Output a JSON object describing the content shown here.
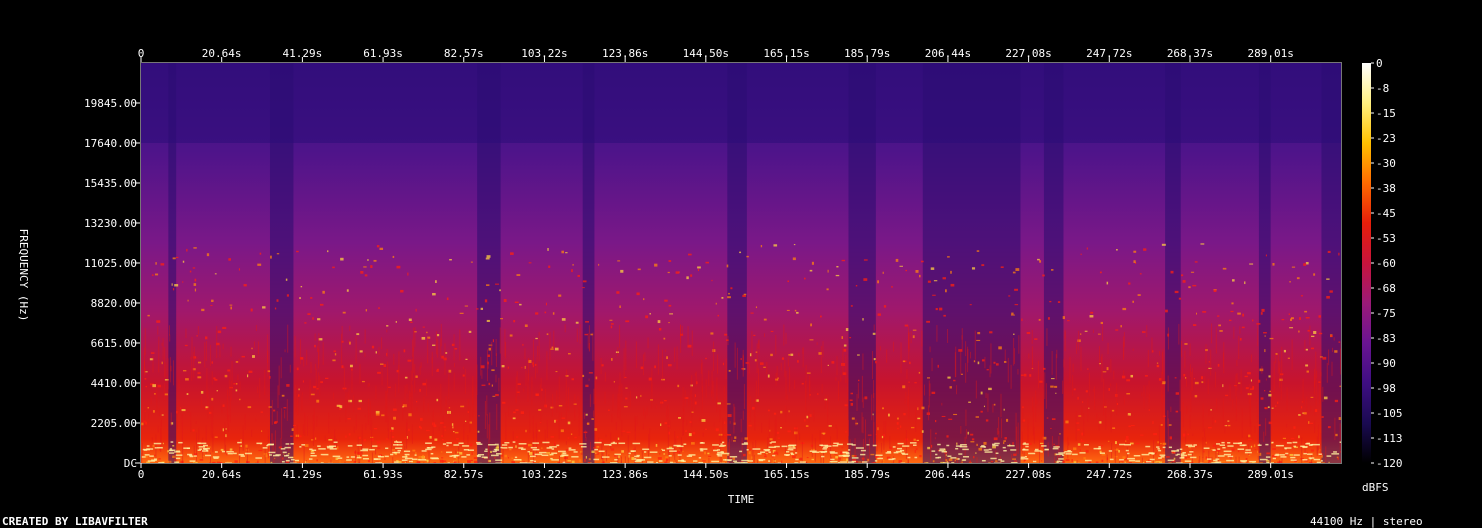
{
  "chart_data": {
    "type": "heatmap",
    "title": "",
    "xlabel": "TIME",
    "ylabel": "FREQUENCY (Hz)",
    "x_ticks": [
      "0",
      "20.64s",
      "41.29s",
      "61.93s",
      "82.57s",
      "103.22s",
      "123.86s",
      "144.50s",
      "165.15s",
      "185.79s",
      "206.44s",
      "227.08s",
      "247.72s",
      "268.37s",
      "289.01s"
    ],
    "x_tick_values": [
      0,
      20.64,
      41.29,
      61.93,
      82.57,
      103.22,
      123.86,
      144.5,
      165.15,
      185.79,
      206.44,
      227.08,
      247.72,
      268.37,
      289.01
    ],
    "xlim": [
      0,
      307
    ],
    "y_ticks": [
      "DC",
      "2205.00",
      "4410.00",
      "6615.00",
      "8820.00",
      "11025.00",
      "13230.00",
      "15435.00",
      "17640.00",
      "19845.00"
    ],
    "y_tick_values": [
      0,
      2205,
      4410,
      6615,
      8820,
      11025,
      13230,
      15435,
      17640,
      19845
    ],
    "ylim": [
      0,
      22050
    ],
    "colorbar": {
      "label": "dBFS",
      "ticks": [
        "0",
        "-8",
        "-15",
        "-23",
        "-30",
        "-38",
        "-45",
        "-53",
        "-60",
        "-68",
        "-75",
        "-83",
        "-90",
        "-98",
        "-105",
        "-113",
        "-120"
      ],
      "range": [
        -120,
        0
      ],
      "colors": [
        "#000000",
        "#1a0a52",
        "#3e0e82",
        "#6a1493",
        "#9b1a78",
        "#c8143c",
        "#e61e0a",
        "#ff6a00",
        "#ffc000",
        "#fff080",
        "#ffffff"
      ]
    }
  },
  "footer": {
    "credit": "CREATED BY LIBAVFILTER",
    "info": "44100 Hz | stereo"
  }
}
